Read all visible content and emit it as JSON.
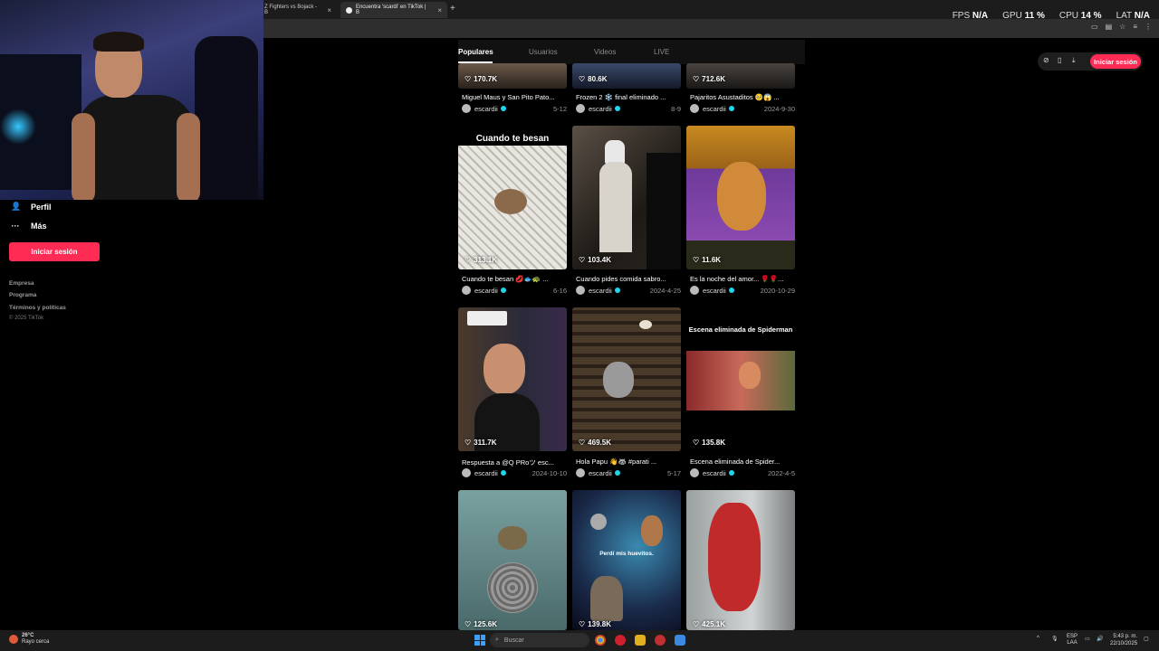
{
  "browser": {
    "tabs": [
      {
        "title": "Z Fighters vs Bojack - B",
        "active": false
      },
      {
        "title": "Encuentra 'scardi' en TikTok | B",
        "active": true
      }
    ],
    "new_tab": "+",
    "close_glyph": "×"
  },
  "overlay": {
    "fps_label": "FPS",
    "fps_value": "N/A",
    "gpu_label": "GPU",
    "gpu_value": "11 %",
    "cpu_label": "CPU",
    "cpu_value": "14 %",
    "lat_label": "LAT",
    "lat_value": "N/A"
  },
  "sidebar": {
    "items": [
      {
        "label": "Perfil",
        "icon": "person-icon"
      },
      {
        "label": "Más",
        "icon": "more-dots-icon"
      }
    ],
    "login_label": "Iniciar sesión",
    "footer_links": [
      "Empresa",
      "Programa",
      "Términos y políticas"
    ],
    "copyright": "© 2025 TikTok"
  },
  "search_tabs": [
    "Populares",
    "Usuarios",
    "Videos",
    "LIVE"
  ],
  "header": {
    "login_label": "Iniciar sesión"
  },
  "videos": [
    {
      "views": "170.7K",
      "title": "Miguel Maus y San Pito Pato...",
      "author": "escardii",
      "date": "5-12"
    },
    {
      "views": "80.6K",
      "title": "Frozen 2 ❄️ final eliminado ...",
      "author": "escardii",
      "date": "8-9"
    },
    {
      "views": "712.6K",
      "title": "Pajaritos Asustaditos 🥺😱 ...",
      "author": "escardii",
      "date": "2024-9-30"
    },
    {
      "views": "313.1K",
      "title": "Cuando te besan 💋🐟🐢 ...",
      "author": "escardii",
      "date": "6-16",
      "caption": "Cuando te besan"
    },
    {
      "views": "103.4K",
      "title": "Cuando pides comida sabro...",
      "author": "escardii",
      "date": "2024-4-25"
    },
    {
      "views": "11.6K",
      "title": "Es la noche del amor... 🌹🌹...",
      "author": "escardii",
      "date": "2020-10-29"
    },
    {
      "views": "311.7K",
      "title": "Respuesta a @Q PRoツ esc...",
      "author": "escardii",
      "date": "2024-10-10"
    },
    {
      "views": "469.5K",
      "title": "Hola Papu 👋🦝 #parati ...",
      "author": "escardii",
      "date": "5-17"
    },
    {
      "views": "135.8K",
      "title": "Escena eliminada de Spider...",
      "author": "escardii",
      "date": "2022-4-5",
      "caption": "Escena eliminada de Spiderman"
    },
    {
      "views": "125.6K",
      "title": "",
      "author": "",
      "date": ""
    },
    {
      "views": "139.8K",
      "title": "",
      "author": "",
      "date": "",
      "caption": "Perdí mis huevitos."
    },
    {
      "views": "425.1K",
      "title": "",
      "author": "",
      "date": ""
    }
  ],
  "taskbar": {
    "temp": "26°C",
    "weather": "Rayo cerca",
    "search_placeholder": "Buscar",
    "lang": "ESP",
    "lang2": "LAA",
    "time": "5:43 p. m.",
    "date": "22/10/2025"
  }
}
